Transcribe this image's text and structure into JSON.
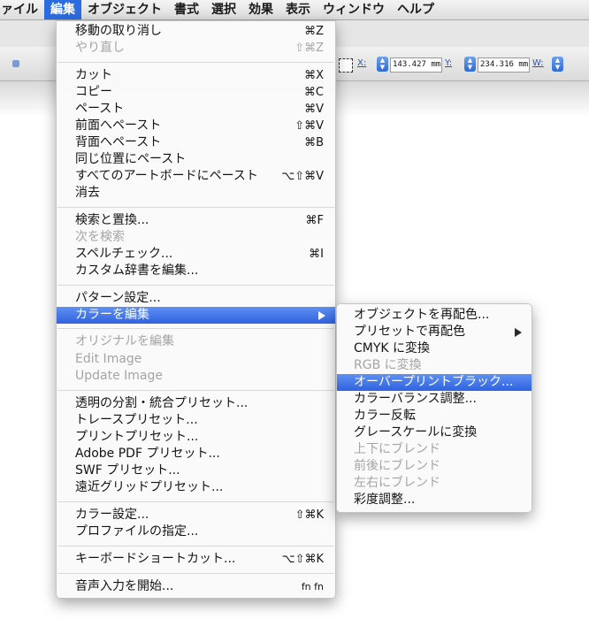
{
  "menubar": {
    "items": [
      "ファイル",
      "編集",
      "オブジェクト",
      "書式",
      "選択",
      "効果",
      "表示",
      "ウィンドウ",
      "ヘルプ"
    ],
    "active_index": 1
  },
  "toolbar": {
    "x_label": "X:",
    "x_value": "143.427 mm",
    "y_label": "Y:",
    "y_value": "234.316 mm",
    "w_label": "W:"
  },
  "edit_menu": {
    "items": [
      {
        "label": "移動の取り消し",
        "shortcut": "⌘Z"
      },
      {
        "label": "やり直し",
        "shortcut": "⇧⌘Z",
        "disabled": true
      },
      {
        "label": "カット",
        "shortcut": "⌘X"
      },
      {
        "label": "コピー",
        "shortcut": "⌘C"
      },
      {
        "label": "ペースト",
        "shortcut": "⌘V"
      },
      {
        "label": "前面へペースト",
        "shortcut": "⇧⌘V"
      },
      {
        "label": "背面へペースト",
        "shortcut": "⌘B"
      },
      {
        "label": "同じ位置にペースト",
        "shortcut": ""
      },
      {
        "label": "すべてのアートボードにペースト",
        "shortcut": "⌥⇧⌘V"
      },
      {
        "label": "消去",
        "shortcut": ""
      },
      {
        "label": "検索と置換...",
        "shortcut": "⌘F"
      },
      {
        "label": "次を検索",
        "shortcut": "",
        "disabled": true
      },
      {
        "label": "スペルチェック...",
        "shortcut": "⌘I"
      },
      {
        "label": "カスタム辞書を編集...",
        "shortcut": ""
      },
      {
        "label": "パターン設定...",
        "shortcut": ""
      },
      {
        "label": "カラーを編集",
        "shortcut": "",
        "highlighted": true,
        "submenu": true
      },
      {
        "label": "オリジナルを編集",
        "shortcut": "",
        "disabled": true
      },
      {
        "label": "Edit Image",
        "shortcut": "",
        "disabled": true
      },
      {
        "label": "Update Image",
        "shortcut": "",
        "disabled": true
      },
      {
        "label": "透明の分割・統合プリセット...",
        "shortcut": ""
      },
      {
        "label": "トレースプリセット...",
        "shortcut": ""
      },
      {
        "label": "プリントプリセット...",
        "shortcut": ""
      },
      {
        "label": "Adobe PDF プリセット...",
        "shortcut": ""
      },
      {
        "label": "SWF プリセット...",
        "shortcut": ""
      },
      {
        "label": "遠近グリッドプリセット...",
        "shortcut": ""
      },
      {
        "label": "カラー設定...",
        "shortcut": "⇧⌘K"
      },
      {
        "label": "プロファイルの指定...",
        "shortcut": ""
      },
      {
        "label": "キーボードショートカット...",
        "shortcut": "⌥⇧⌘K"
      },
      {
        "label": "音声入力を開始...",
        "shortcut": "fn fn"
      }
    ]
  },
  "color_submenu": {
    "items": [
      {
        "label": "オブジェクトを再配色..."
      },
      {
        "label": "プリセットで再配色",
        "submenu": true
      },
      {
        "label": "CMYK に変換"
      },
      {
        "label": "RGB に変換",
        "disabled": true
      },
      {
        "label": "オーバープリントブラック...",
        "highlighted": true
      },
      {
        "label": "カラーバランス調整..."
      },
      {
        "label": "カラー反転"
      },
      {
        "label": "グレースケールに変換"
      },
      {
        "label": "上下にブレンド",
        "disabled": true
      },
      {
        "label": "前後にブレンド",
        "disabled": true
      },
      {
        "label": "左右にブレンド",
        "disabled": true
      },
      {
        "label": "彩度調整..."
      }
    ]
  },
  "colors": {
    "highlight": "#3a6fe6",
    "disabled_text": "#a4a4a4",
    "menu_bg": "#fafafa"
  }
}
